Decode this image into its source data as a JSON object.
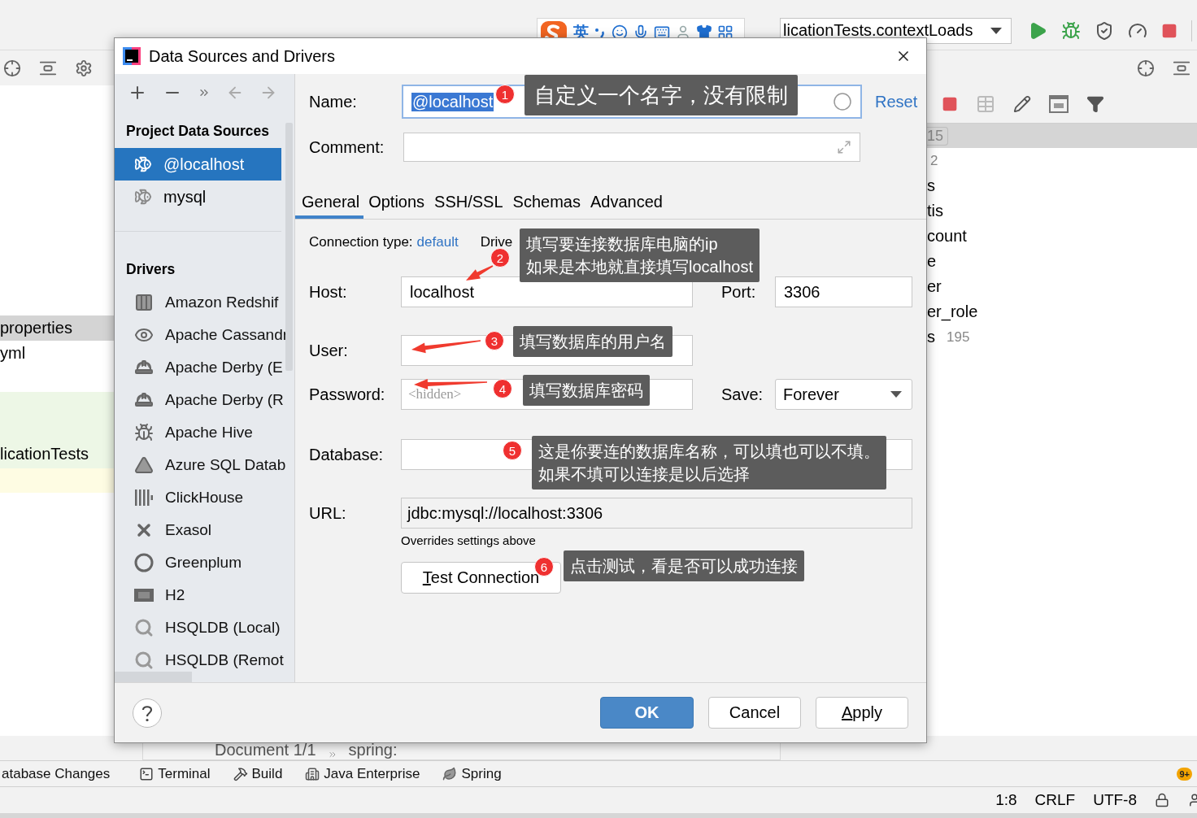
{
  "ide": {
    "ime": {
      "mode": "英"
    },
    "run_config": "licationTests.contextLoads",
    "project_files": [
      {
        "label": "properties",
        "selected": true,
        "modified": false
      },
      {
        "label": "yml",
        "selected": false,
        "modified": false
      },
      {
        "label": "licationTests",
        "selected": false,
        "modified": true
      }
    ],
    "db_tree": {
      "header_count": "15",
      "rows": [
        {
          "count": "2"
        },
        {
          "name": "s"
        },
        {
          "name": "tis"
        },
        {
          "name": "count"
        },
        {
          "name": "e"
        },
        {
          "name": "er"
        },
        {
          "name": "er_role"
        },
        {
          "name": "s",
          "count": "195"
        }
      ]
    },
    "breadcrumb": [
      "Document 1/1",
      "spring:"
    ],
    "tool_windows": [
      {
        "label": "atabase Changes",
        "kind": "none"
      },
      {
        "label": "Terminal",
        "kind": "terminal"
      },
      {
        "label": "Build",
        "kind": "build"
      },
      {
        "label": "Java Enterprise",
        "kind": "enterprise"
      },
      {
        "label": "Spring",
        "kind": "spring"
      }
    ],
    "notifications": "9+",
    "status_bar": [
      "1:8",
      "CRLF",
      "UTF-8"
    ]
  },
  "dialog": {
    "title": "Data Sources and Drivers",
    "sidebar": {
      "project_header": "Project Data Sources",
      "data_sources": [
        {
          "name": "@localhost",
          "selected": true
        },
        {
          "name": "mysql",
          "selected": false
        }
      ],
      "drivers_header": "Drivers",
      "drivers": [
        "Amazon Redshif",
        "Apache Cassandr",
        "Apache Derby (E",
        "Apache Derby (R",
        "Apache Hive",
        "Azure SQL Datab",
        "ClickHouse",
        "Exasol",
        "Greenplum",
        "H2",
        "HSQLDB (Local)",
        "HSQLDB (Remot"
      ]
    },
    "form": {
      "name": {
        "label": "Name:",
        "value": "@localhost"
      },
      "reset": "Reset",
      "comment": {
        "label": "Comment:"
      },
      "tabs": [
        {
          "label": "General",
          "selected": true
        },
        {
          "label": "Options",
          "selected": false
        },
        {
          "label": "SSH/SSL",
          "selected": false
        },
        {
          "label": "Schemas",
          "selected": false
        },
        {
          "label": "Advanced",
          "selected": false
        }
      ],
      "connection_type": {
        "label": "Connection type:",
        "value": "default"
      },
      "driver_label": "Drive",
      "host": {
        "label": "Host:",
        "value": "localhost"
      },
      "port": {
        "label": "Port:",
        "value": "3306"
      },
      "user": {
        "label": "User:"
      },
      "password": {
        "label": "Password:",
        "placeholder": "<hidden>"
      },
      "save": {
        "label": "Save:",
        "value": "Forever"
      },
      "database": {
        "label": "Database:"
      },
      "url": {
        "label": "URL:",
        "value": "jdbc:mysql://localhost:3306",
        "note": "Overrides settings above"
      },
      "test_button": "Test Connection"
    },
    "footer": {
      "ok": "OK",
      "cancel": "Cancel",
      "apply": "Apply"
    }
  },
  "annotations": [
    {
      "number": "1",
      "lines": [
        "自定义一个名字，没有限制"
      ]
    },
    {
      "number": "2",
      "lines": [
        "填写要连接数据库电脑的ip",
        "如果是本地就直接填写localhost"
      ]
    },
    {
      "number": "3",
      "lines": [
        "填写数据库的用户名"
      ]
    },
    {
      "number": "4",
      "lines": [
        "填写数据库密码"
      ]
    },
    {
      "number": "5",
      "lines": [
        "这是你要连的数据库名称，可以填也可以不填。",
        "如果不填可以连接是以后选择"
      ]
    },
    {
      "number": "6",
      "lines": [
        "点击测试，看是否可以成功连接"
      ]
    }
  ]
}
